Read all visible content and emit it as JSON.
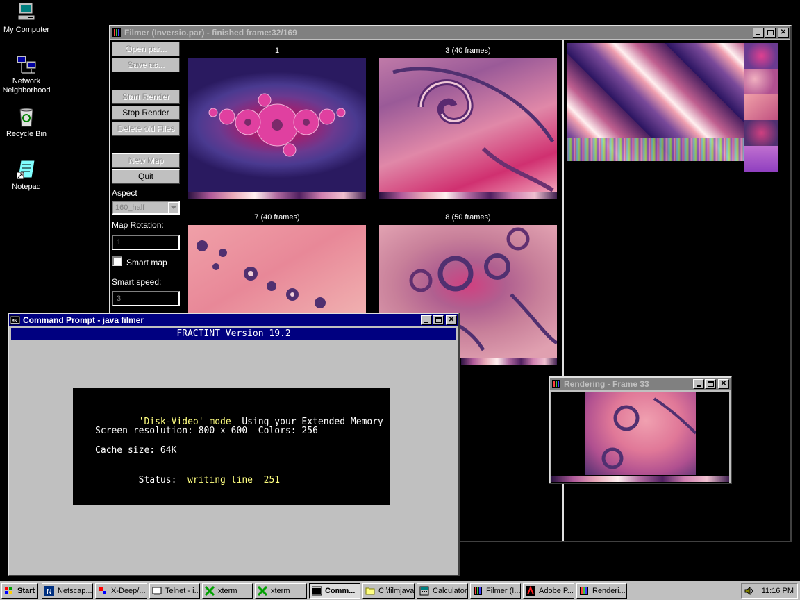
{
  "desktop": {
    "icons": [
      {
        "label": "My Computer"
      },
      {
        "label": "Network Neighborhood"
      },
      {
        "label": "Recycle Bin"
      },
      {
        "label": "Notepad"
      }
    ]
  },
  "filmer": {
    "title": "Filmer  (Inversio.par) - finished frame:32/169",
    "buttons": {
      "open": "Open par...",
      "save": "Save as...",
      "start": "Start Render",
      "stop": "Stop Render",
      "delete": "Delete old Files",
      "newmap": "New Map",
      "quit": "Quit"
    },
    "aspect_label": "Aspect",
    "aspect_value": "160_half",
    "rotation_label": "Map Rotation:",
    "rotation_value": "1",
    "smartmap_label": "Smart map",
    "smartspeed_label": "Smart speed:",
    "smartspeed_value": "3",
    "frames": [
      {
        "label": "1"
      },
      {
        "label": "3 (40 frames)"
      },
      {
        "label": "7 (40 frames)"
      },
      {
        "label": "8 (50 frames)"
      }
    ]
  },
  "cmd": {
    "title": "Command Prompt - java filmer",
    "banner": "FRACTINT Version 19.2",
    "mode_key": "'Disk-Video' mode",
    "mode_val": "Using your Extended Memory",
    "res_line": "Screen resolution: 800 x 600  Colors: 256",
    "cache_line": "Cache size: 64K",
    "status_key": "Status:",
    "status_val": "writing line  251"
  },
  "rendering": {
    "title": "Rendering - Frame 33"
  },
  "taskbar": {
    "start": "Start",
    "items": [
      {
        "label": "Netscap..."
      },
      {
        "label": "X-Deep/..."
      },
      {
        "label": "Telnet - i..."
      },
      {
        "label": "xterm"
      },
      {
        "label": "xterm"
      },
      {
        "label": "Comm..."
      },
      {
        "label": "C:\\filmjava"
      },
      {
        "label": "Calculator"
      },
      {
        "label": "Filmer  (I..."
      },
      {
        "label": "Adobe P..."
      },
      {
        "label": "Renderi..."
      }
    ],
    "clock": "11:16 PM"
  },
  "colors": {
    "titlebar_active": "#000080",
    "titlebar_inactive": "#808080",
    "window_face": "#c0c0c0",
    "console_yellow": "#ffff80"
  }
}
